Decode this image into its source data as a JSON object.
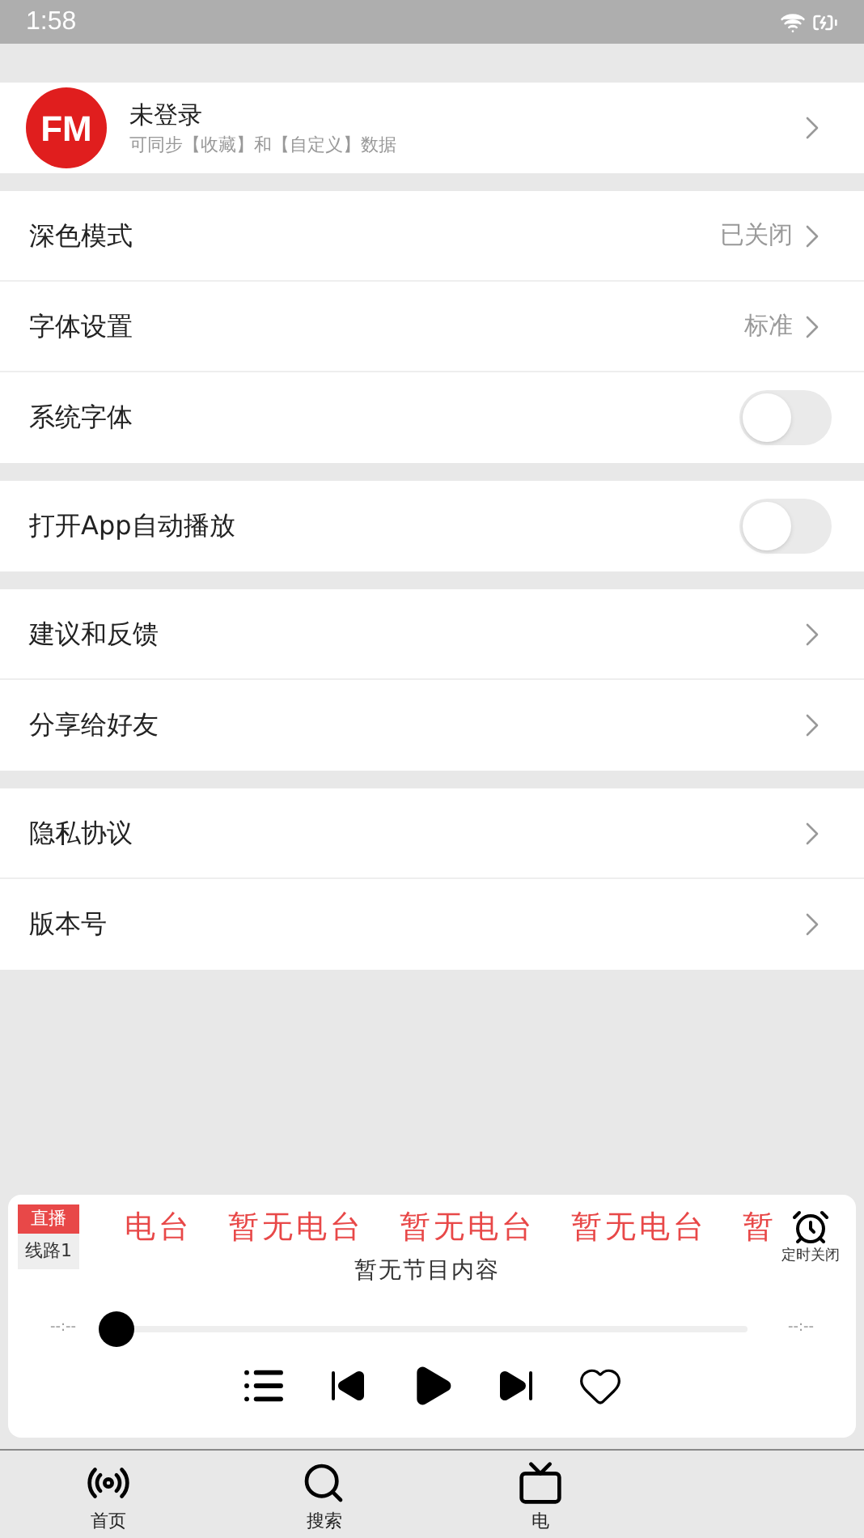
{
  "status_bar": {
    "time": "1:58"
  },
  "profile": {
    "name": "未登录",
    "subtitle": "可同步【收藏】和【自定义】数据",
    "logo": "FM"
  },
  "settings_groups": [
    {
      "items": [
        {
          "kind": "value",
          "label": "深色模式",
          "value": "已关闭"
        },
        {
          "kind": "value",
          "label": "字体设置",
          "value": "标准"
        },
        {
          "kind": "toggle",
          "label": "系统字体",
          "on": false
        }
      ]
    },
    {
      "items": [
        {
          "kind": "toggle",
          "label": "打开App自动播放",
          "on": false
        }
      ]
    },
    {
      "items": [
        {
          "kind": "link",
          "label": "建议和反馈"
        },
        {
          "kind": "link",
          "label": "分享给好友"
        }
      ]
    },
    {
      "items": [
        {
          "kind": "link",
          "label": "隐私协议"
        },
        {
          "kind": "link",
          "label": "版本号"
        }
      ]
    }
  ],
  "player": {
    "live_badge": "直播",
    "line_badge": "线路1",
    "marquee": [
      "电台",
      "暂无电台",
      "暂无电台",
      "暂无电台",
      "暂"
    ],
    "program": "暂无节目内容",
    "timer_label": "定时关闭",
    "elapsed": "--:--",
    "total": "--:--",
    "progress": {
      "level": 0
    },
    "favorite": false
  },
  "bottom_nav": [
    {
      "kind": "home",
      "label": "首页"
    },
    {
      "kind": "search",
      "label": "搜索"
    },
    {
      "kind": "station",
      "label": "电"
    }
  ]
}
